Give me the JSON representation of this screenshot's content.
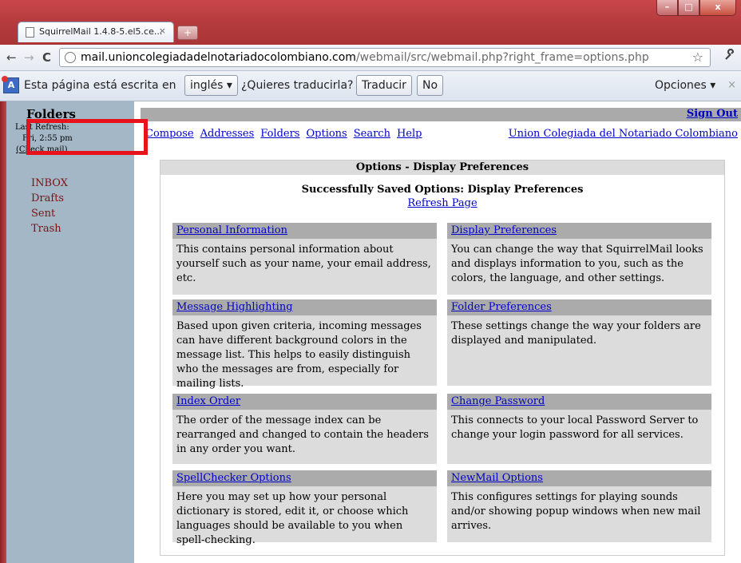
{
  "browser": {
    "tab_title": "SquirrelMail 1.4.8-5.el5.ce...",
    "tab_close": "×",
    "new_tab": "+",
    "window_controls": {
      "minimize": "–",
      "maximize": "□",
      "close": "x"
    },
    "url_host": "mail.unioncolegiadadelnotariadocolombiano.com",
    "url_path": "/webmail/src/webmail.php?right_frame=options.php",
    "back": "←",
    "forward": "→",
    "reload": "C",
    "star": "☆",
    "wrench": "🔧"
  },
  "translate_bar": {
    "icon": "A",
    "text_before": "Esta página está escrita en",
    "language": "inglés ▾",
    "question": "¿Quieres traducirla?",
    "translate_button": "Traducir",
    "no_button": "No",
    "options": "Opciones ▾",
    "close": "×"
  },
  "sidebar": {
    "title": "Folders",
    "last_refresh_label": "Last Refresh:",
    "last_refresh_time": "Fri, 2:55 pm",
    "check_mail": "(Check mail)",
    "folders": [
      "INBOX",
      "Drafts",
      "Sent",
      "Trash"
    ]
  },
  "header": {
    "sign_out": "Sign Out",
    "menu": [
      "Compose",
      "Addresses",
      "Folders",
      "Options",
      "Search",
      "Help"
    ],
    "org_link": "Union Colegiada del Notariado Colombiano"
  },
  "options": {
    "title": "Options - Display Preferences",
    "saved_message": "Successfully Saved Options: Display Preferences",
    "refresh_link": "Refresh Page",
    "items": [
      {
        "title": "Personal Information",
        "desc": "This contains personal information about yourself such as your name, your email address, etc."
      },
      {
        "title": "Display Preferences",
        "desc": "You can change the way that SquirrelMail looks and displays information to you, such as the colors, the language, and other settings."
      },
      {
        "title": "Message Highlighting",
        "desc": "Based upon given criteria, incoming messages can have different background colors in the message list. This helps to easily distinguish who the messages are from, especially for mailing lists."
      },
      {
        "title": "Folder Preferences",
        "desc": "These settings change the way your folders are displayed and manipulated."
      },
      {
        "title": "Index Order",
        "desc": "The order of the message index can be rearranged and changed to contain the headers in any order you want."
      },
      {
        "title": "Change Password",
        "desc": "This connects to your local Password Server to change your login password for all services."
      },
      {
        "title": "SpellChecker Options",
        "desc": "Here you may set up how your personal dictionary is stored, edit it, or choose which languages should be available to you when spell-checking."
      },
      {
        "title": "NewMail Options",
        "desc": "This configures settings for playing sounds and/or showing popup windows when new mail arrives."
      }
    ]
  },
  "colors": {
    "sidebar_bg": "#a4b7c7",
    "folder_link": "#7a1313",
    "link": "#0000cc",
    "highlight_box": "#e8121b",
    "title_bar": "#b33a3c"
  }
}
